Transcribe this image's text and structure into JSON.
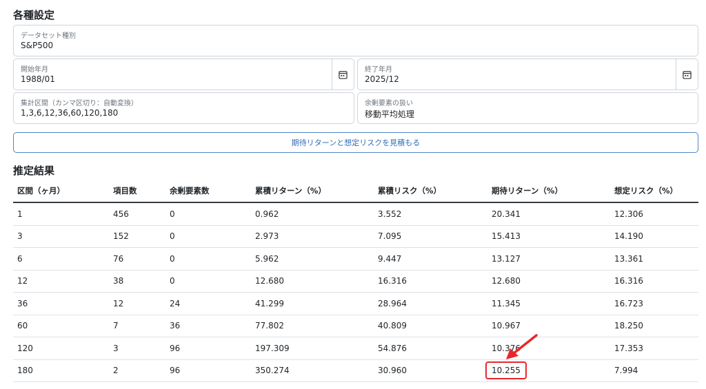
{
  "settings": {
    "heading": "各種設定",
    "dataset": {
      "label": "データセット種別",
      "value": "S&P500"
    },
    "start": {
      "label": "開始年月",
      "value": "1988/01",
      "icon": "calendar-icon"
    },
    "end": {
      "label": "終了年月",
      "value": "2025/12",
      "icon": "calendar-icon"
    },
    "intervals": {
      "label": "集計区間（カンマ区切り：自動変換）",
      "value": "1,3,6,12,36,60,120,180"
    },
    "remainder": {
      "label": "余剰要素の扱い",
      "value": "移動平均処理"
    },
    "estimate_button": "期待リターンと想定リスクを見積もる"
  },
  "results": {
    "heading": "推定結果",
    "columns": [
      "区間（ヶ月）",
      "項目数",
      "余剰要素数",
      "累積リターン（%）",
      "累積リスク（%）",
      "期待リターン（%）",
      "想定リスク（%）"
    ],
    "rows": [
      [
        "1",
        "456",
        "0",
        "0.962",
        "3.552",
        "20.341",
        "12.306"
      ],
      [
        "3",
        "152",
        "0",
        "2.973",
        "7.095",
        "15.413",
        "14.190"
      ],
      [
        "6",
        "76",
        "0",
        "5.962",
        "9.447",
        "13.127",
        "13.361"
      ],
      [
        "12",
        "38",
        "0",
        "12.680",
        "16.316",
        "12.680",
        "16.316"
      ],
      [
        "36",
        "12",
        "24",
        "41.299",
        "28.964",
        "11.345",
        "16.723"
      ],
      [
        "60",
        "7",
        "36",
        "77.802",
        "40.809",
        "10.967",
        "18.250"
      ],
      [
        "120",
        "3",
        "96",
        "197.309",
        "54.876",
        "10.376",
        "17.353"
      ],
      [
        "180",
        "2",
        "96",
        "350.274",
        "30.960",
        "10.255",
        "7.994"
      ]
    ],
    "highlight_color": "#e8262b"
  }
}
